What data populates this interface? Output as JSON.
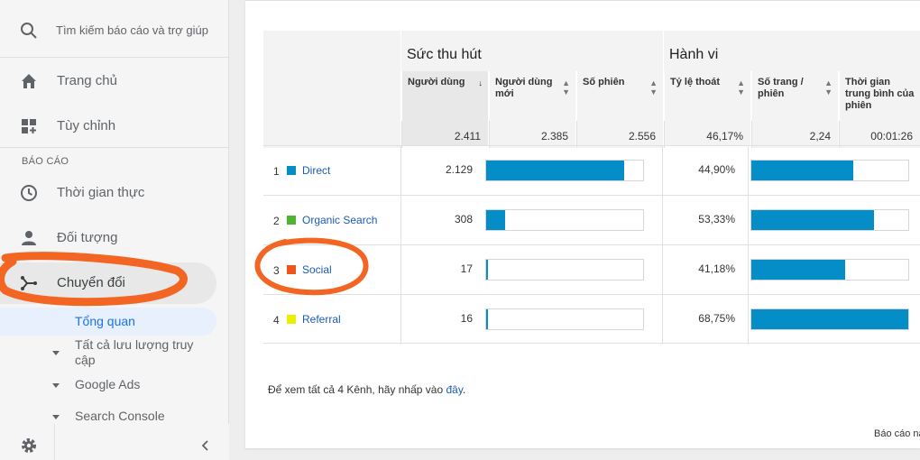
{
  "sidebar": {
    "search_placeholder": "Tìm kiếm báo cáo và trợ giúp",
    "home_label": "Trang chủ",
    "custom_label": "Tùy chỉnh",
    "section_reports": "BÁO CÁO",
    "realtime_label": "Thời gian thực",
    "audience_label": "Đối tượng",
    "conversion_label": "Chuyển đổi",
    "overview_label": "Tổng quan",
    "all_traffic_label": "Tất cả lưu lượng truy cập",
    "google_ads_label": "Google Ads",
    "search_console_label": "Search Console"
  },
  "table": {
    "group_acquisition": "Sức thu hút",
    "group_behavior": "Hành vi",
    "col_users": "Người dùng",
    "col_new_users": "Người dùng mới",
    "col_sessions": "Số phiên",
    "col_bounce": "Tỷ lệ thoát",
    "col_pages_session": "Số trang / phiên",
    "col_duration": "Thời gian trung bình của phiên",
    "totals": {
      "users": "2.411",
      "new_users": "2.385",
      "sessions": "2.556",
      "bounce": "46,17%",
      "pages_session": "2,24",
      "duration": "00:01:26"
    },
    "rows": [
      {
        "rank": "1",
        "channel": "Direct",
        "color": "#058dc7",
        "users": "2.129",
        "sessions_fraction": 0.88,
        "bounce": "44,90%",
        "pages_fraction": 0.65
      },
      {
        "rank": "2",
        "channel": "Organic Search",
        "color": "#50b432",
        "users": "308",
        "sessions_fraction": 0.12,
        "bounce": "53,33%",
        "pages_fraction": 0.78
      },
      {
        "rank": "3",
        "channel": "Social",
        "color": "#ed561b",
        "users": "17",
        "sessions_fraction": 0.01,
        "bounce": "41,18%",
        "pages_fraction": 0.6
      },
      {
        "rank": "4",
        "channel": "Referral",
        "color": "#edef00",
        "users": "16",
        "sessions_fraction": 0.01,
        "bounce": "68,75%",
        "pages_fraction": 1.0
      }
    ]
  },
  "footer": {
    "note_prefix": "Để xem tất cả 4 Kênh, hãy nhấp vào ",
    "note_link": "đây",
    "note_suffix": ".",
    "report_label": "Báo cáo nà"
  },
  "colors": {
    "accent": "#1a73e8",
    "bar": "#058dc7",
    "annotation": "#f26522"
  }
}
